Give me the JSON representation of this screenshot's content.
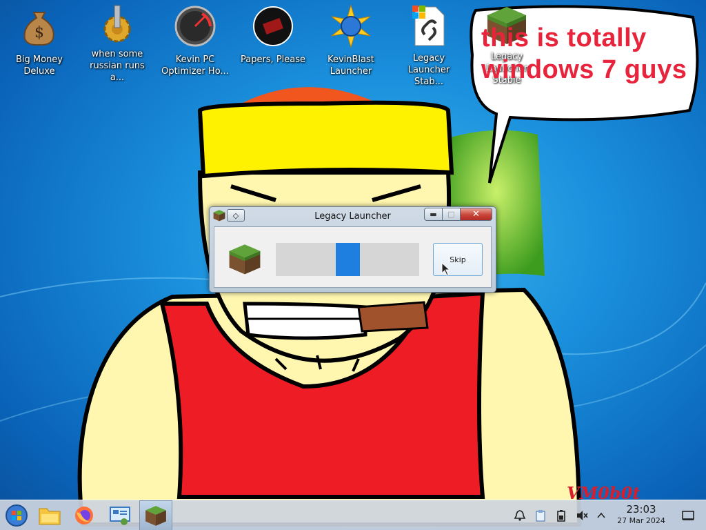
{
  "desktop": {
    "icons": [
      {
        "id": "big-money",
        "label": "Big Money\nDeluxe",
        "glyph": "money-bag-icon"
      },
      {
        "id": "russian",
        "label": "when some\nrussian runs a...",
        "glyph": "gear-icon"
      },
      {
        "id": "kevin-pc",
        "label": "Kevin PC\nOptimizer Ho...",
        "glyph": "speedometer-icon"
      },
      {
        "id": "papers",
        "label": "Papers, Please",
        "glyph": "papers-please-icon"
      },
      {
        "id": "kevinblast",
        "label": "KevinBlast\nLauncher",
        "glyph": "globe-burst-icon"
      },
      {
        "id": "legacy-shortcut",
        "label": "Legacy\nLauncher Stab...",
        "glyph": "shortcut-file-icon"
      },
      {
        "id": "legacy",
        "label": "Legacy\nLauncher Stable",
        "glyph": "grass-block-icon"
      }
    ],
    "bubble_text": "this is totally\nwindows 7 guys",
    "signature": "VM0b0t"
  },
  "window": {
    "title": "Legacy Launcher",
    "pin_glyph": "◇",
    "minimize_glyph": "▬",
    "maximize_glyph": "□",
    "close_glyph": "✕",
    "skip_label": "Skip",
    "progress_indeterminate_position": 0.5
  },
  "taskbar": {
    "items": [
      "start-orb-icon",
      "file-manager-icon",
      "firefox-icon",
      "control-panel-icon",
      "legacy-launcher-task-icon"
    ],
    "tray": [
      "notification-bell-icon",
      "clipboard-icon",
      "battery-icon",
      "volume-muted-icon",
      "tray-expand-icon"
    ],
    "time": "23:03",
    "date": "27 Mar 2024",
    "show_desktop": "show-desktop-icon"
  },
  "colors": {
    "accent": "#1e7fe0",
    "bubble_text": "#e8243c",
    "progress_track": "#d6d6d6"
  }
}
